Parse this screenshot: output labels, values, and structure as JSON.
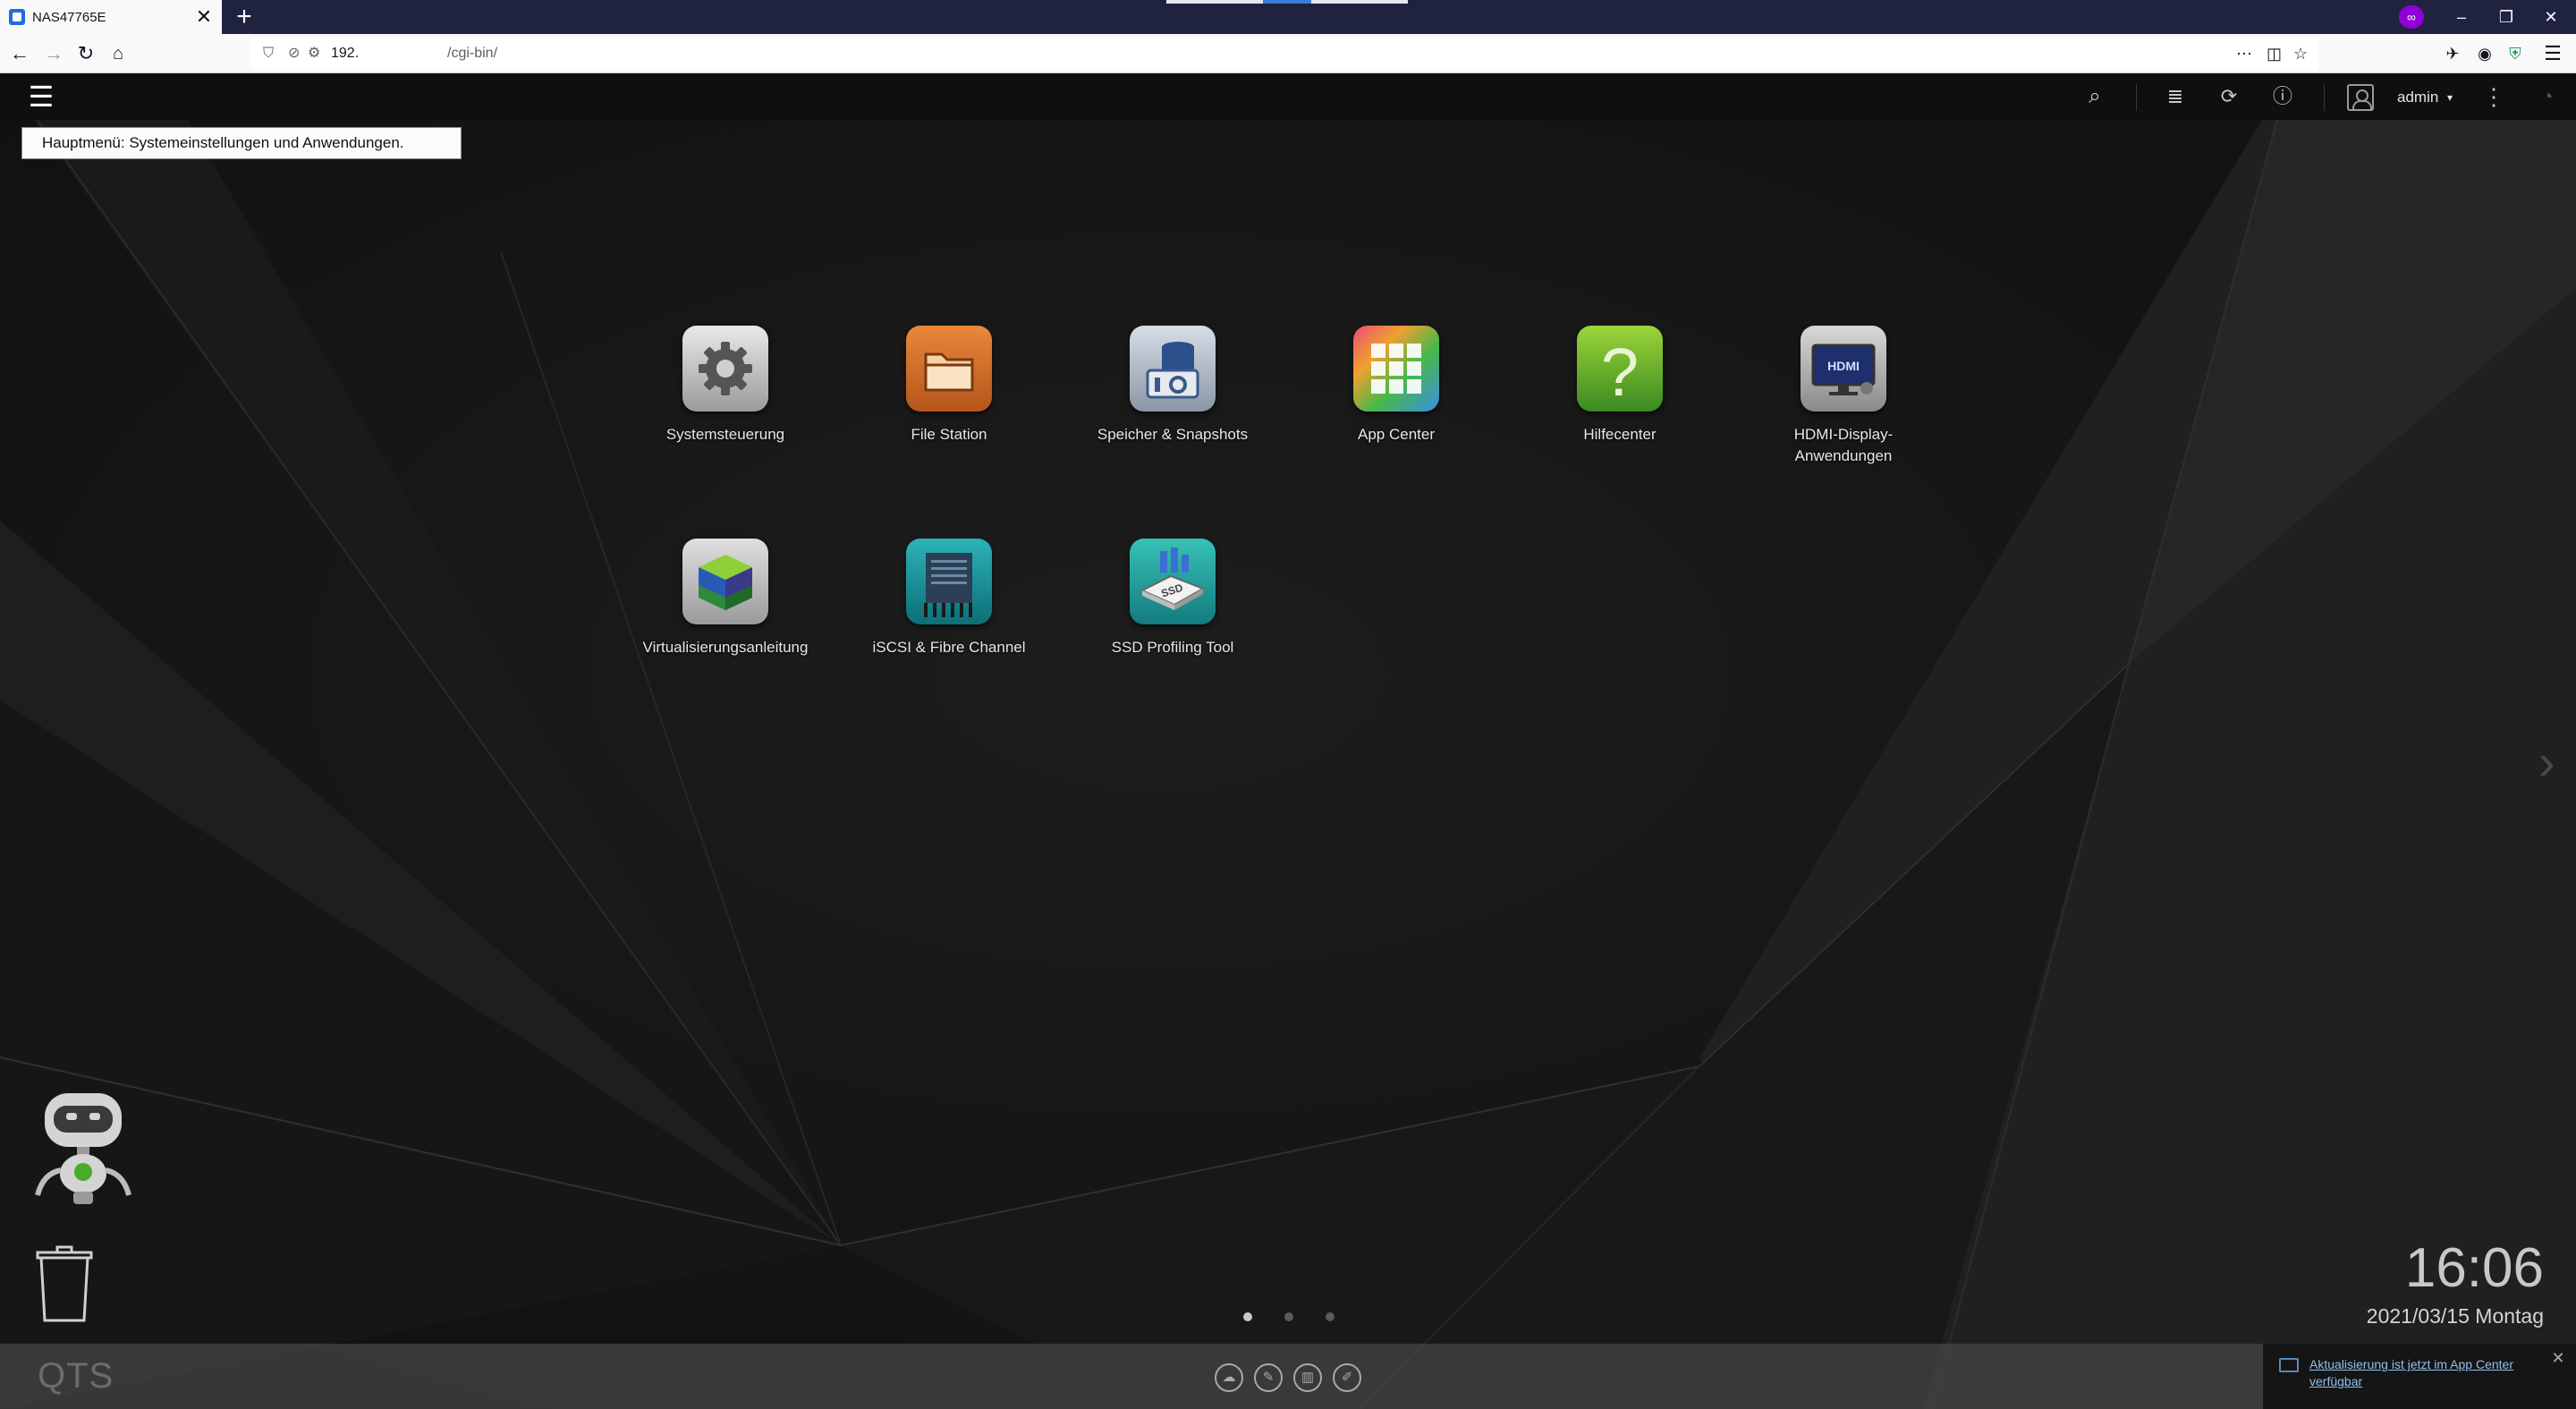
{
  "browser": {
    "tab_title": "NAS47765E",
    "tab_close": "✕",
    "new_tab": "+",
    "url_host": "192.",
    "url_path": "/cgi-bin/",
    "window_controls": {
      "minimize": "–",
      "restore": "❐",
      "close": "✕"
    }
  },
  "qts": {
    "topbar": {
      "menu_icon": "☰",
      "user_name": "admin",
      "caret": "▾"
    },
    "tooltip": "Hauptmenü: Systemeinstellungen und Anwendungen.",
    "apps": [
      {
        "label": "Systemsteuerung",
        "icon": "gear-icon"
      },
      {
        "label": "File Station",
        "icon": "folder-icon"
      },
      {
        "label": "Speicher & Snapshots",
        "icon": "storage-icon"
      },
      {
        "label": "App Center",
        "icon": "app-grid-icon"
      },
      {
        "label": "Hilfecenter",
        "icon": "question-icon"
      },
      {
        "label": "HDMI-Display-\nAnwendungen",
        "icon": "hdmi-monitor-icon"
      },
      {
        "label": "Virtualisierungsanleitung",
        "icon": "cube-icon"
      },
      {
        "label": "iSCSI & Fibre Channel",
        "icon": "iscsi-icon"
      },
      {
        "label": "SSD Profiling Tool",
        "icon": "ssd-icon"
      }
    ],
    "pages": {
      "count": 3,
      "active": 1
    },
    "clock": "16:06",
    "date": "2021/03/15 Montag",
    "taskbar": {
      "logo": "QTS"
    },
    "notification": {
      "text": "Aktualisierung ist jetzt im App Center verfügbar",
      "close": "✕"
    },
    "colors": {
      "dot_active": "#c9c9c9",
      "dot_inactive": "#5a5a5a",
      "link": "#8fc0ee"
    }
  }
}
